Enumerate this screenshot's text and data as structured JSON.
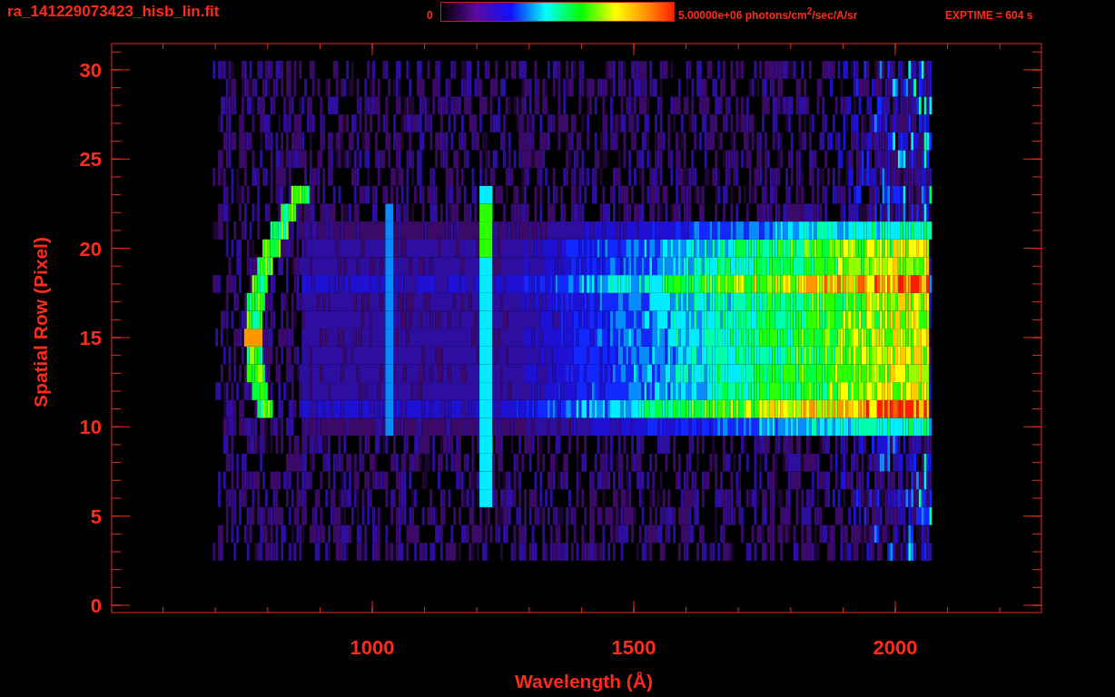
{
  "header": {
    "title": "ra_141229073423_hisb_lin.fit",
    "colorbar": {
      "min_label": "0",
      "max_label": "5.00000e+06 photons/cm$^{2}$/sec/A/sr"
    },
    "exptime": "EXPTIME = 604 s"
  },
  "plot": {
    "ylabel": "Spatial Row (Pixel)",
    "xlabel": "Wavelength (Å)",
    "yticks": [
      "30",
      "25",
      "20",
      "15",
      "10",
      "5",
      "0"
    ],
    "xticks": [
      "1000",
      "1500",
      "2000"
    ]
  }
}
